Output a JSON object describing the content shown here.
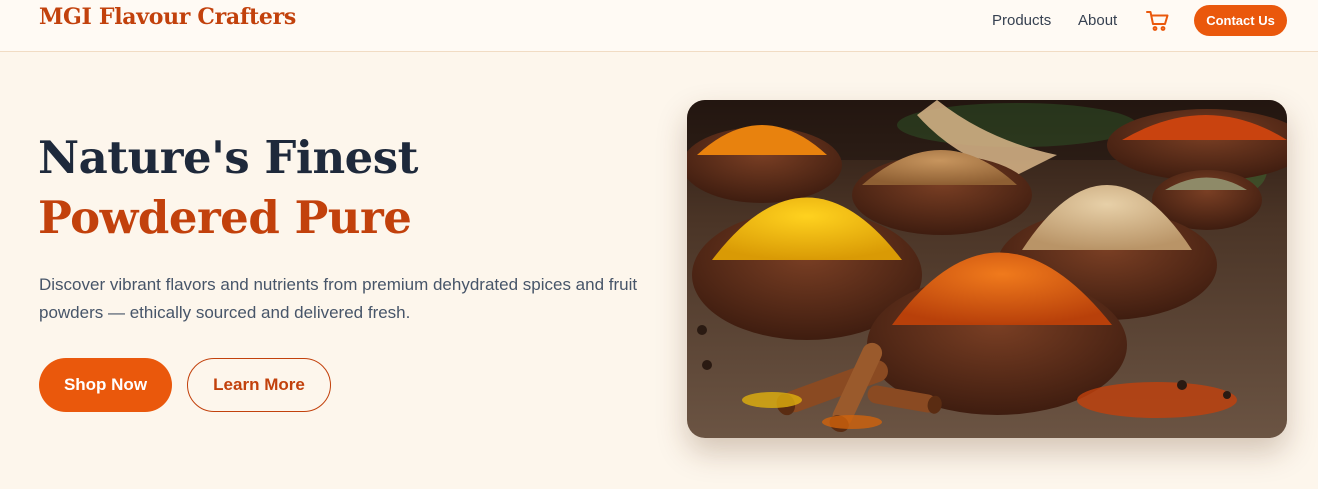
{
  "header": {
    "brand": "MGI Flavour Crafters",
    "nav": [
      {
        "label": "Products"
      },
      {
        "label": "About"
      }
    ],
    "cart_icon": "shopping-cart-icon",
    "contact_label": "Contact Us"
  },
  "hero": {
    "title_line1": "Nature's Finest",
    "title_line2": "Powdered Pure",
    "description": "Discover vibrant flavors and nutrients from premium dehydrated spices and fruit powders — ethically sourced and delivered fresh.",
    "primary_button": "Shop Now",
    "secondary_button": "Learn More",
    "image_subject": "bowls of powdered spices (turmeric, paprika, chili, ginger) with cinnamon sticks on wooden table"
  },
  "colors": {
    "accent": "#ea580c",
    "brand": "#c2410c",
    "heading": "#1e293b",
    "background": "#fdf6ec"
  }
}
